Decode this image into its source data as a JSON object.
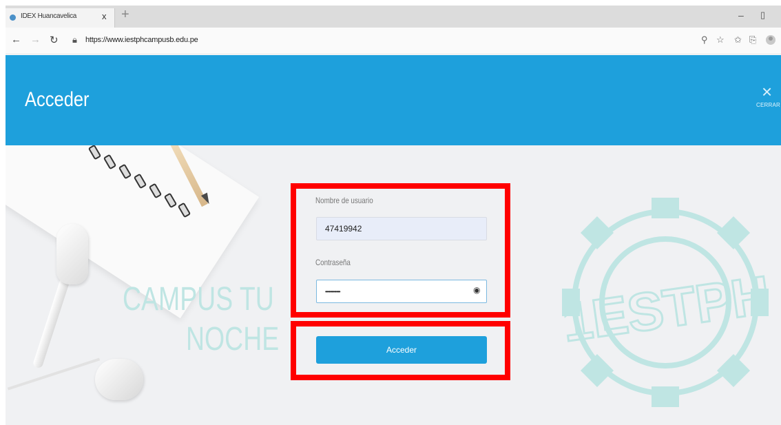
{
  "browser": {
    "tab_title": "IDEX Huancavelica",
    "tab_close": "x",
    "new_tab": "+",
    "url": "https://www.iestphcampusb.edu.pe",
    "minimize": "–",
    "restore": "▯"
  },
  "header": {
    "title": "Acceder",
    "close_label": "CERRAR",
    "close_icon": "×"
  },
  "background": {
    "watermark_line1": "CAMPUS TU",
    "watermark_line2": "NOCHE",
    "seal_text": "1ESTPH"
  },
  "form": {
    "username_label": "Nombre de usuario",
    "username_value": "47419942",
    "password_label": "Contraseña",
    "password_value": "••••••••••••",
    "submit_label": "Acceder"
  },
  "colors": {
    "header_bg": "#1ea0dc",
    "highlight": "#ff0000"
  }
}
